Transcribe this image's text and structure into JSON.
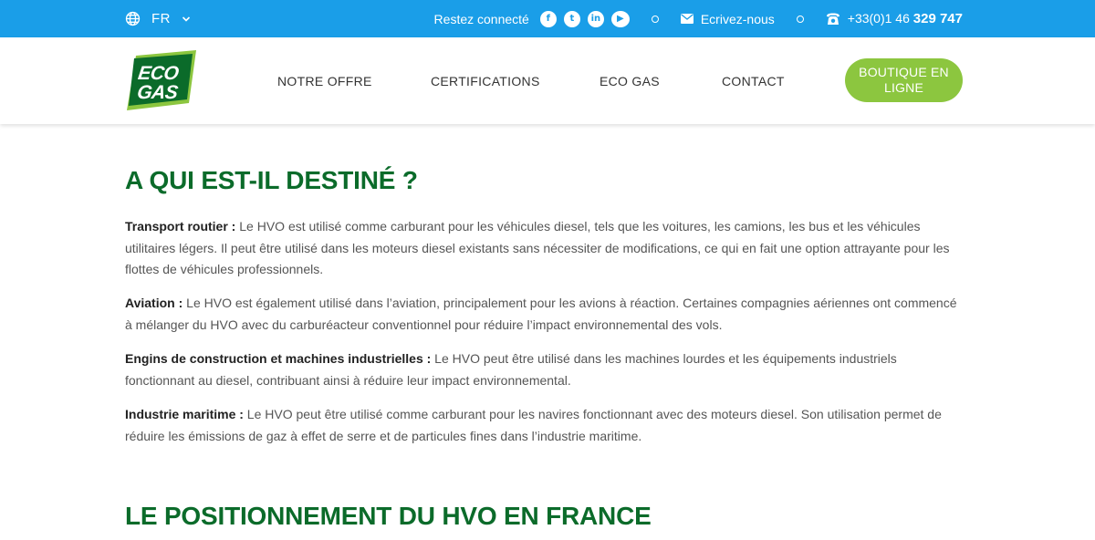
{
  "topbar": {
    "lang": "FR",
    "restez": "Restez connecté",
    "social": [
      {
        "icon": "facebook-icon",
        "glyph": "f"
      },
      {
        "icon": "twitter-icon",
        "glyph": "t"
      },
      {
        "icon": "linkedin-icon",
        "glyph": "in"
      },
      {
        "icon": "youtube-icon",
        "glyph": "▶"
      }
    ],
    "contact_label": "Ecrivez-nous",
    "phone_prefix": "+33(0)1 46 ",
    "phone_bold": "329 747"
  },
  "nav": {
    "items": [
      "NOTRE OFFRE",
      "CERTIFICATIONS",
      "ECO GAS",
      "CONTACT"
    ],
    "shop_label": "BOUTIQUE EN LIGNE"
  },
  "logo": {
    "line1": "ECO",
    "line2": "GAS"
  },
  "colors": {
    "topbar": "#1a9ee8",
    "heading": "#0b6b2a",
    "button": "#8cc63f"
  },
  "sections": [
    {
      "title": "A QUI EST-IL DESTINÉ ?",
      "paragraphs": [
        {
          "label": "Transport routier :",
          "text": " Le HVO est utilisé comme carburant pour les véhicules diesel, tels que les voitures, les camions, les bus et les véhicules utilitaires légers. Il peut être utilisé dans les moteurs diesel existants sans nécessiter de modifications, ce qui en fait une option attrayante pour les flottes de véhicules professionnels."
        },
        {
          "label": "Aviation :",
          "text": " Le HVO est également utilisé dans l’aviation, principalement pour les avions à réaction. Certaines compagnies aériennes ont commencé à mélanger du HVO avec du carburéacteur conventionnel pour réduire l’impact environnemental des vols."
        },
        {
          "label": "Engins de construction et machines industrielles :",
          "text": " Le HVO peut être utilisé dans les machines lourdes et les équipements industriels fonctionnant au diesel, contribuant ainsi à réduire leur impact environnemental."
        },
        {
          "label": "Industrie maritime :",
          "text": " Le HVO peut être utilisé comme carburant pour les navires fonctionnant avec des moteurs diesel. Son utilisation permet de réduire les émissions de gaz à effet de serre et de particules fines dans l’industrie maritime."
        }
      ]
    },
    {
      "title": "LE POSITIONNEMENT DU HVO EN FRANCE"
    }
  ]
}
